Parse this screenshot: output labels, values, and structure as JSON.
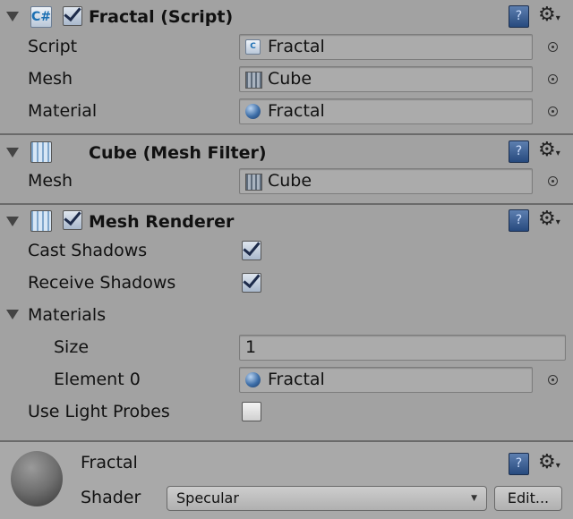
{
  "components": [
    {
      "title": "Fractal (Script)",
      "icon": "csharp-script-icon",
      "enabled": true,
      "fields": [
        {
          "label": "Script",
          "value": "Fractal",
          "icon": "script-icon"
        },
        {
          "label": "Mesh",
          "value": "Cube",
          "icon": "mesh-icon"
        },
        {
          "label": "Material",
          "value": "Fractal",
          "icon": "material-icon"
        }
      ]
    },
    {
      "title": "Cube (Mesh Filter)",
      "icon": "mesh-filter-icon",
      "fields": [
        {
          "label": "Mesh",
          "value": "Cube",
          "icon": "mesh-icon"
        }
      ]
    },
    {
      "title": "Mesh Renderer",
      "icon": "mesh-renderer-icon",
      "enabled": true,
      "cast_shadows": {
        "label": "Cast Shadows",
        "checked": true
      },
      "receive_shadows": {
        "label": "Receive Shadows",
        "checked": true
      },
      "materials": {
        "label": "Materials",
        "size_label": "Size",
        "size": "1",
        "element_label": "Element 0",
        "element_value": "Fractal"
      },
      "light_probes": {
        "label": "Use Light Probes",
        "checked": false
      }
    }
  ],
  "material": {
    "name": "Fractal",
    "shader_label": "Shader",
    "shader": "Specular",
    "edit_label": "Edit..."
  },
  "help_glyph": "?",
  "gear_glyph": "⚙"
}
